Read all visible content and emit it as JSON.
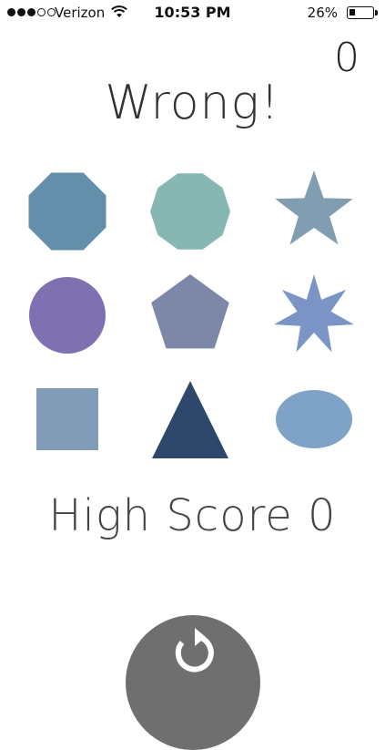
{
  "status_bar": {
    "signal_dots_filled": 3,
    "signal_dots_total": 5,
    "carrier": "Verizon",
    "time": "10:53 PM",
    "battery_percent": "26%",
    "battery_level": 0.26
  },
  "game": {
    "score": "0",
    "result_text": "Wrong!",
    "high_score_text": "High Score 0"
  },
  "shapes": [
    {
      "name": "octagon-shape",
      "shape": "octagon",
      "color": "#648FAA"
    },
    {
      "name": "decagon-shape",
      "shape": "decagon",
      "color": "#87B7B2"
    },
    {
      "name": "star-shape",
      "shape": "star5",
      "color": "#809DB2"
    },
    {
      "name": "circle-shape",
      "shape": "circle",
      "color": "#7E70B1"
    },
    {
      "name": "pentagon-shape",
      "shape": "pentagon",
      "color": "#7D88A9"
    },
    {
      "name": "seven-point-star-shape",
      "shape": "star7",
      "color": "#7B94C6"
    },
    {
      "name": "square-shape",
      "shape": "square",
      "color": "#7F9BB5"
    },
    {
      "name": "triangle-shape",
      "shape": "triangle",
      "color": "#2E486C"
    },
    {
      "name": "ellipse-shape",
      "shape": "ellipse",
      "color": "#7EA3C6"
    }
  ],
  "restart_button": {
    "icon": "refresh-icon",
    "color": "#6F6F6F"
  }
}
